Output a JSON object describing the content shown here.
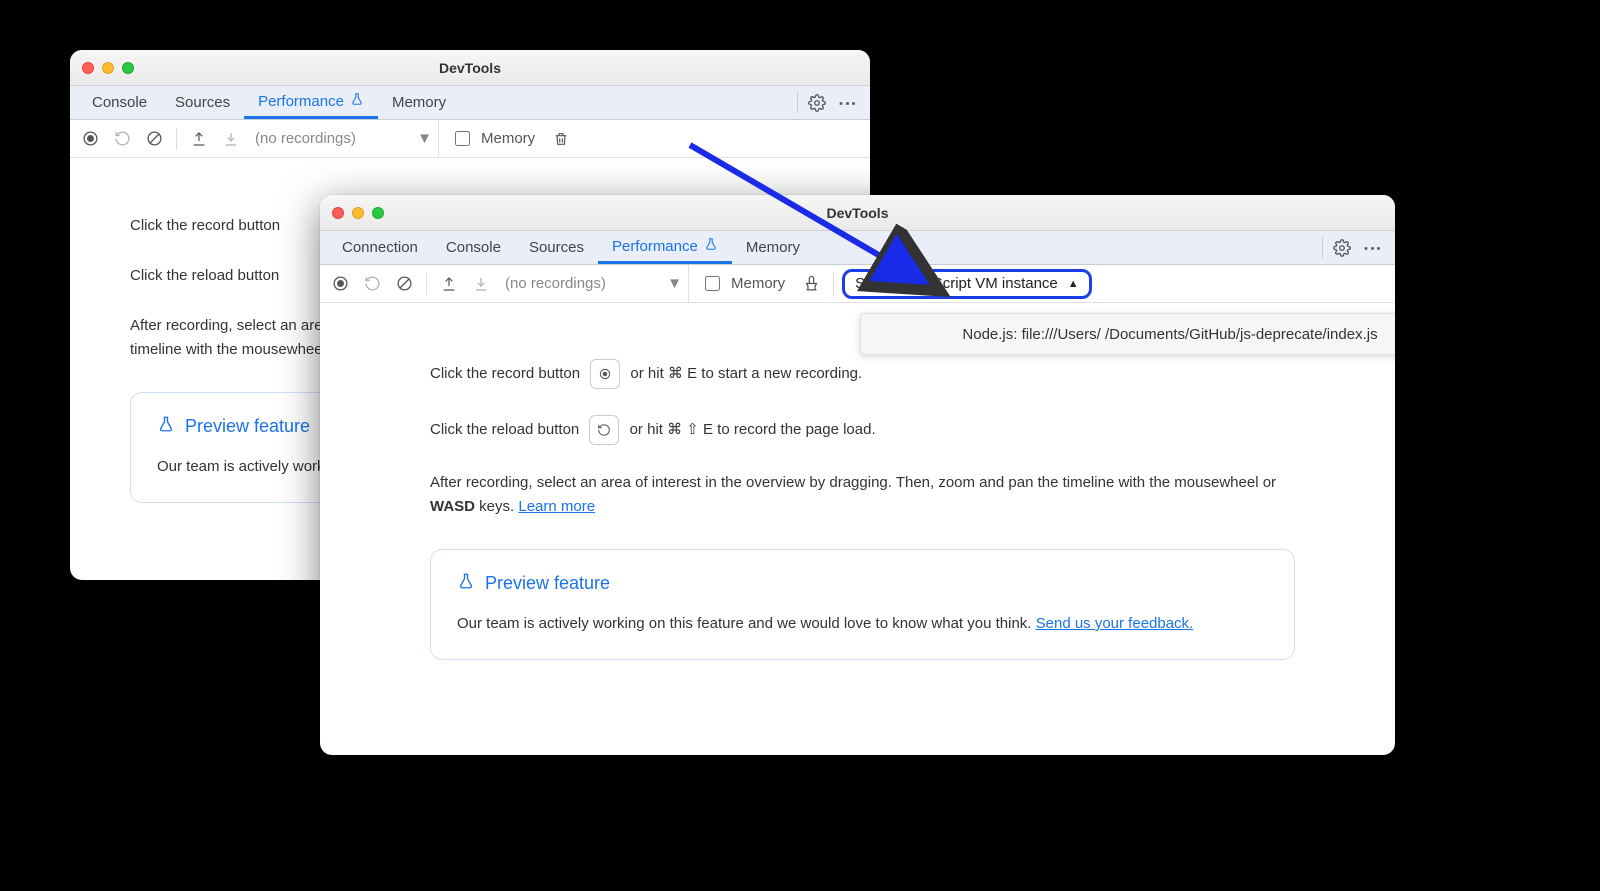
{
  "window_title": "DevTools",
  "tabs_back": [
    "Console",
    "Sources",
    "Performance",
    "Memory"
  ],
  "tabs_front": [
    "Connection",
    "Console",
    "Sources",
    "Performance",
    "Memory"
  ],
  "active_tab": "Performance",
  "recordings_placeholder": "(no recordings)",
  "memory_label": "Memory",
  "select_vm_label": "Select JavaScript VM instance",
  "vm_option_text": "Node.js: file:///Users/        /Documents/GitHub/js-deprecate/index.js",
  "hint_record_pre": "Click the record button ",
  "hint_record_post": " or hit ⌘ E to start a new recording.",
  "hint_reload_pre": "Click the reload button ",
  "hint_reload_post": " or hit ⌘ ⇧ E to record the page load.",
  "hint_after_1": "After recording, select an area of interest in the overview by dragging. Then, zoom and pan the timeline with the mousewheel or ",
  "hint_wasd": "WASD",
  "hint_after_2": " keys. ",
  "learn_more": "Learn more",
  "preview_title": "Preview feature",
  "preview_body_1": "Our team is actively working on this feature and we would love to know what you think. ",
  "preview_link": "Send us your feedback.",
  "truncated": {
    "hint_record": "Click the record button",
    "hint_reload": "Click the reload button",
    "hint_after": "After recording, select an area of interest in the overview by dragging. Then, zoom and pan the timeline with the mousewheel or WASD keys.",
    "preview_body": "Our team is actively working on this feature and we would love to know what you think."
  }
}
